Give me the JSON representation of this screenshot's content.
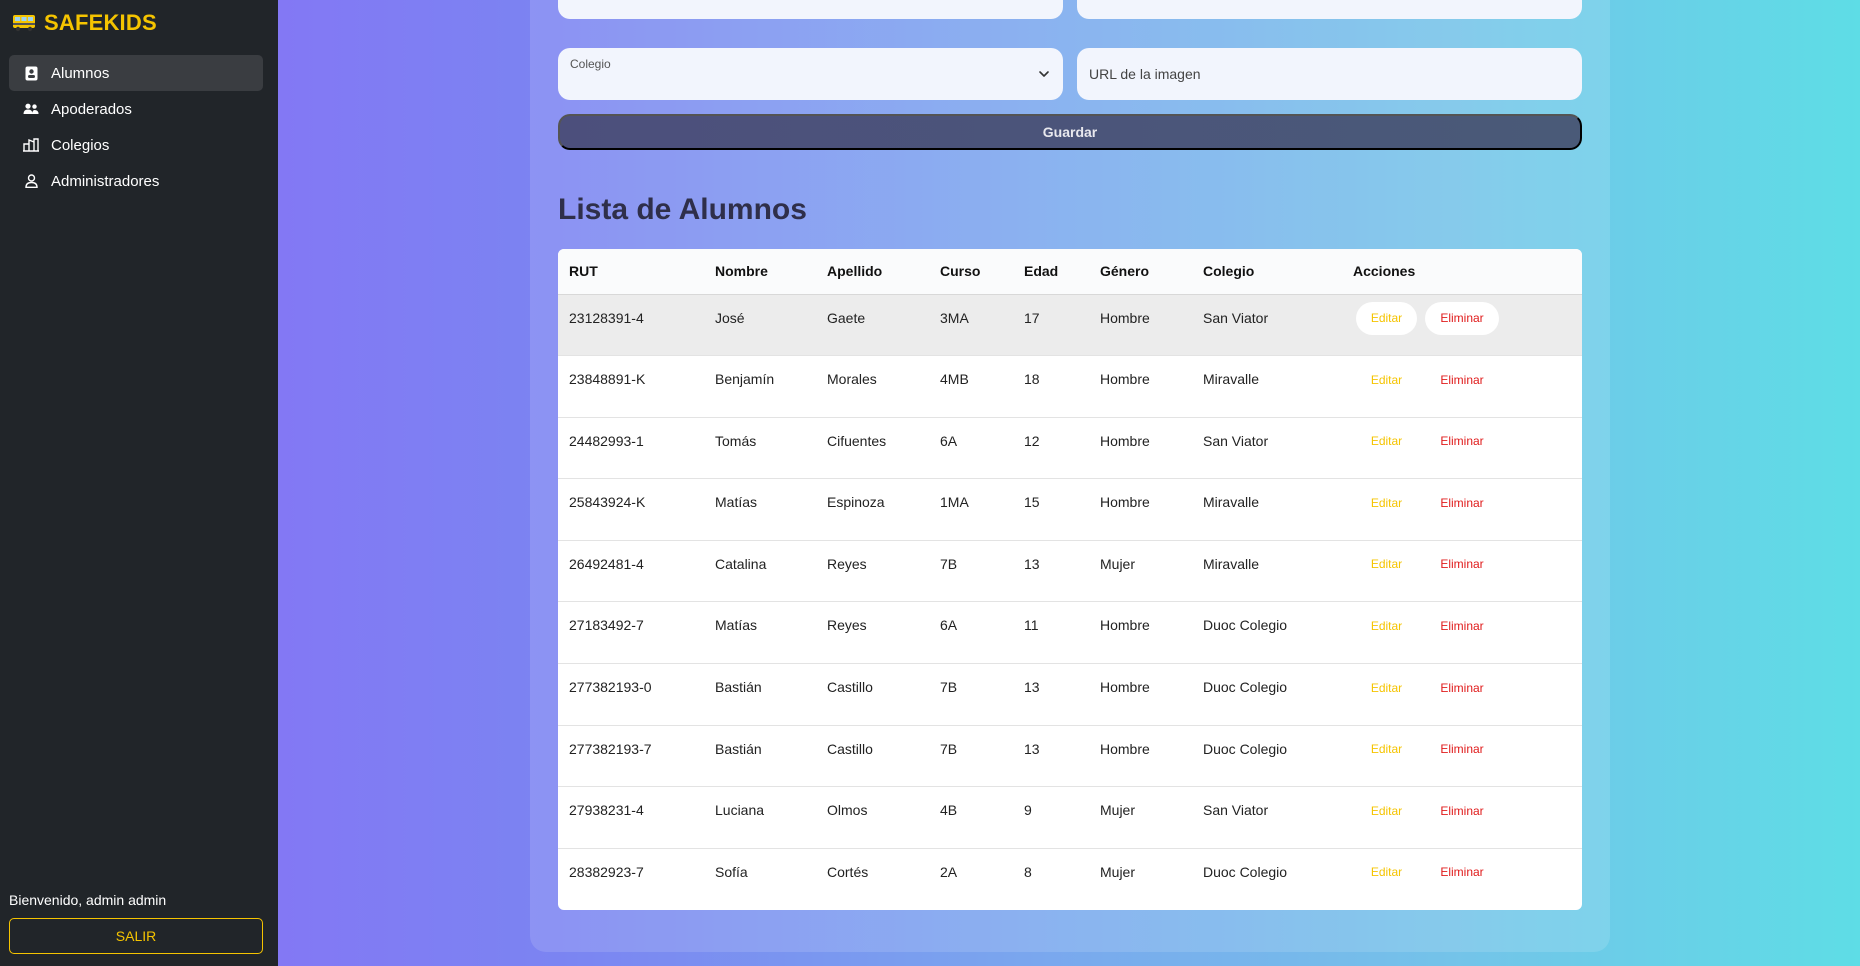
{
  "brand": {
    "name": "SAFEKIDS",
    "accent": "#f5c400"
  },
  "sidebar": {
    "items": [
      {
        "label": "Alumnos",
        "icon": "student-badge-icon",
        "active": true
      },
      {
        "label": "Apoderados",
        "icon": "users-icon",
        "active": false
      },
      {
        "label": "Colegios",
        "icon": "building-icon",
        "active": false
      },
      {
        "label": "Administradores",
        "icon": "user-icon",
        "active": false
      }
    ],
    "welcome": "Bienvenido, admin admin",
    "logout_label": "SALIR"
  },
  "form": {
    "colegio_label": "Colegio",
    "url_placeholder": "URL de la imagen",
    "save_label": "Guardar"
  },
  "list": {
    "title": "Lista de Alumnos",
    "headers": [
      "RUT",
      "Nombre",
      "Apellido",
      "Curso",
      "Edad",
      "Género",
      "Colegio",
      "Acciones"
    ],
    "edit_label": "Editar",
    "delete_label": "Eliminar",
    "rows": [
      {
        "rut": "23128391-4",
        "nombre": "José",
        "apellido": "Gaete",
        "curso": "3MA",
        "edad": "17",
        "genero": "Hombre",
        "colegio": "San Viator"
      },
      {
        "rut": "23848891-K",
        "nombre": "Benjamín",
        "apellido": "Morales",
        "curso": "4MB",
        "edad": "18",
        "genero": "Hombre",
        "colegio": "Miravalle"
      },
      {
        "rut": "24482993-1",
        "nombre": "Tomás",
        "apellido": "Cifuentes",
        "curso": "6A",
        "edad": "12",
        "genero": "Hombre",
        "colegio": "San Viator"
      },
      {
        "rut": "25843924-K",
        "nombre": "Matías",
        "apellido": "Espinoza",
        "curso": "1MA",
        "edad": "15",
        "genero": "Hombre",
        "colegio": "Miravalle"
      },
      {
        "rut": "26492481-4",
        "nombre": "Catalina",
        "apellido": "Reyes",
        "curso": "7B",
        "edad": "13",
        "genero": "Mujer",
        "colegio": "Miravalle"
      },
      {
        "rut": "27183492-7",
        "nombre": "Matías",
        "apellido": "Reyes",
        "curso": "6A",
        "edad": "11",
        "genero": "Hombre",
        "colegio": "Duoc Colegio"
      },
      {
        "rut": "277382193-0",
        "nombre": "Bastián",
        "apellido": "Castillo",
        "curso": "7B",
        "edad": "13",
        "genero": "Hombre",
        "colegio": "Duoc Colegio"
      },
      {
        "rut": "277382193-7",
        "nombre": "Bastián",
        "apellido": "Castillo",
        "curso": "7B",
        "edad": "13",
        "genero": "Hombre",
        "colegio": "Duoc Colegio"
      },
      {
        "rut": "27938231-4",
        "nombre": "Luciana",
        "apellido": "Olmos",
        "curso": "4B",
        "edad": "9",
        "genero": "Mujer",
        "colegio": "San Viator"
      },
      {
        "rut": "28382923-7",
        "nombre": "Sofía",
        "apellido": "Cortés",
        "curso": "2A",
        "edad": "8",
        "genero": "Mujer",
        "colegio": "Duoc Colegio"
      }
    ]
  }
}
